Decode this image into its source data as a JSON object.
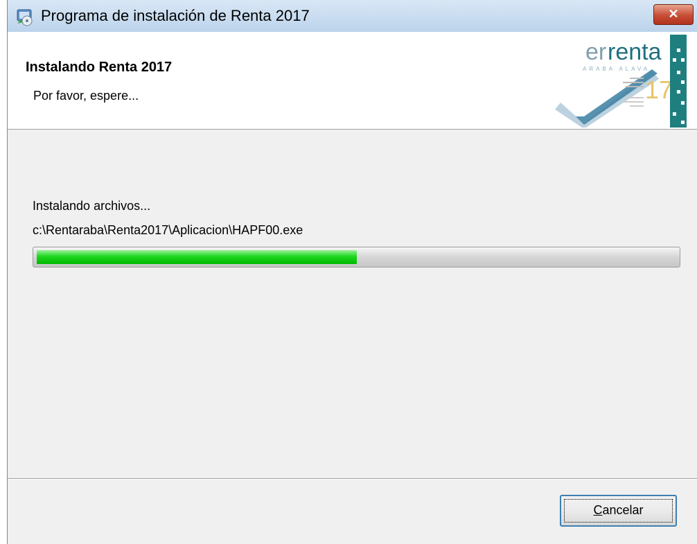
{
  "window": {
    "title": "Programa de instalación de Renta 2017",
    "close_icon": "close-icon"
  },
  "header": {
    "title": "Instalando Renta 2017",
    "subtitle": "Por favor, espere...",
    "logo": {
      "wordmark_prefix": "er",
      "wordmark_suffix": "renta",
      "region": "ARABA ALAVA",
      "year_digits": "17"
    }
  },
  "main": {
    "status_label": "Instalando archivos...",
    "file_path": "c:\\Rentaraba\\Renta2017\\Aplicacion\\HAPF00.exe",
    "progress_percent": 50
  },
  "footer": {
    "cancel_accel": "C",
    "cancel_rest": "ancelar"
  },
  "colors": {
    "progress_fill": "#1fd61f",
    "logo_teal": "#1f7f7f",
    "close_button": "#c74d36"
  }
}
